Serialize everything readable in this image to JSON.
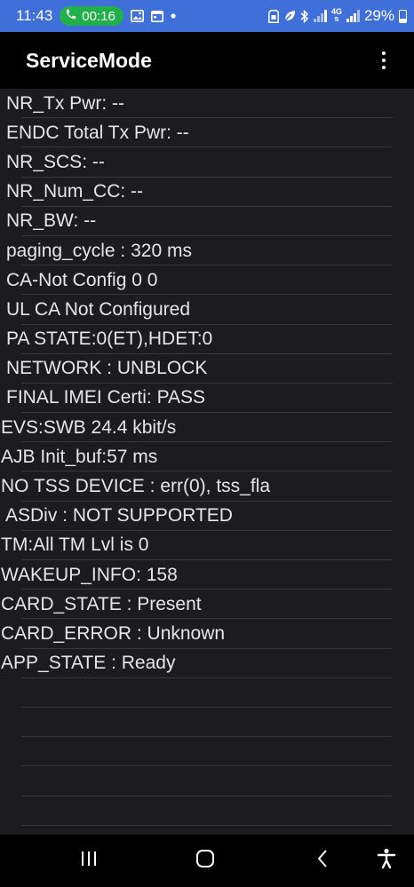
{
  "status_bar": {
    "time": "11:43",
    "call_duration": "00:16",
    "network": "4G",
    "battery": "29%"
  },
  "app_bar": {
    "title": "ServiceMode"
  },
  "rows": [
    {
      "text": "NR_Tx Pwr: --",
      "indent": "indent"
    },
    {
      "text": "ENDC Total Tx Pwr: --",
      "indent": "indent"
    },
    {
      "text": "NR_SCS: --",
      "indent": "indent"
    },
    {
      "text": "NR_Num_CC: --",
      "indent": "indent"
    },
    {
      "text": "NR_BW: --",
      "indent": "indent"
    },
    {
      "text": "paging_cycle : 320 ms",
      "indent": "indent"
    },
    {
      "text": "CA-Not Config 0 0",
      "indent": "indent"
    },
    {
      "text": "UL CA Not Configured",
      "indent": "indent"
    },
    {
      "text": "PA STATE:0(ET),HDET:0",
      "indent": "indent"
    },
    {
      "text": "NETWORK : UNBLOCK",
      "indent": "indent"
    },
    {
      "text": "FINAL IMEI Certi: PASS",
      "indent": "indent"
    },
    {
      "text": "EVS:SWB 24.4 kbit/s",
      "indent": "flush"
    },
    {
      "text": "AJB Init_buf:57 ms",
      "indent": "flush"
    },
    {
      "text": "NO TSS DEVICE : err(0), tss_fla",
      "indent": "flush"
    },
    {
      "text": "ASDiv : NOT SUPPORTED",
      "indent": "indent2"
    },
    {
      "text": "TM:All TM Lvl is 0",
      "indent": "flush"
    },
    {
      "text": "WAKEUP_INFO: 158",
      "indent": "flush"
    },
    {
      "text": "CARD_STATE : Present",
      "indent": "flush"
    },
    {
      "text": "CARD_ERROR : Unknown",
      "indent": "flush"
    },
    {
      "text": "APP_STATE : Ready",
      "indent": "flush"
    },
    {
      "text": "",
      "indent": "flush"
    },
    {
      "text": "",
      "indent": "flush"
    },
    {
      "text": "",
      "indent": "flush"
    },
    {
      "text": "",
      "indent": "flush"
    },
    {
      "text": "",
      "indent": "flush"
    }
  ],
  "nav_bar": {
    "recents_icon": "recents-icon",
    "home_icon": "home-icon",
    "back_icon": "back-icon",
    "accessibility_icon": "accessibility-icon"
  }
}
